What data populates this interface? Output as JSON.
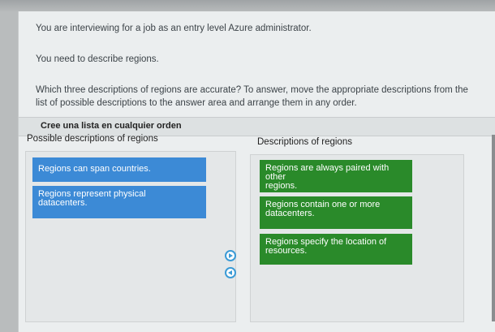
{
  "question": {
    "line1": "You are interviewing for a job as an entry level Azure administrator.",
    "line2": "You need to describe regions.",
    "line3": "Which three descriptions of regions are accurate? To answer, move the appropriate descriptions from the",
    "line4": "list of possible descriptions to the answer area and arrange them in any order."
  },
  "instruction_bar": "Cree una lista en cualquier orden",
  "left": {
    "title": "Possible descriptions of regions",
    "items": [
      {
        "text": "Regions can span countries."
      },
      {
        "line1": "Regions represent physical",
        "line2": "datacenters."
      }
    ]
  },
  "right": {
    "title": "Descriptions of regions",
    "items": [
      {
        "line1": "Regions are always paired with other",
        "line2": "regions."
      },
      {
        "line1": "Regions contain one or more",
        "line2": "datacenters."
      },
      {
        "line1": "Regions specify the location of",
        "line2": "resources."
      }
    ]
  },
  "icons": {
    "move_right": "arrow-right-circle-icon",
    "move_left": "arrow-left-circle-icon"
  },
  "colors": {
    "possible_item": "#3c8ad6",
    "answer_item": "#2a8a2a",
    "arrow_outline": "#3b9bd6"
  }
}
